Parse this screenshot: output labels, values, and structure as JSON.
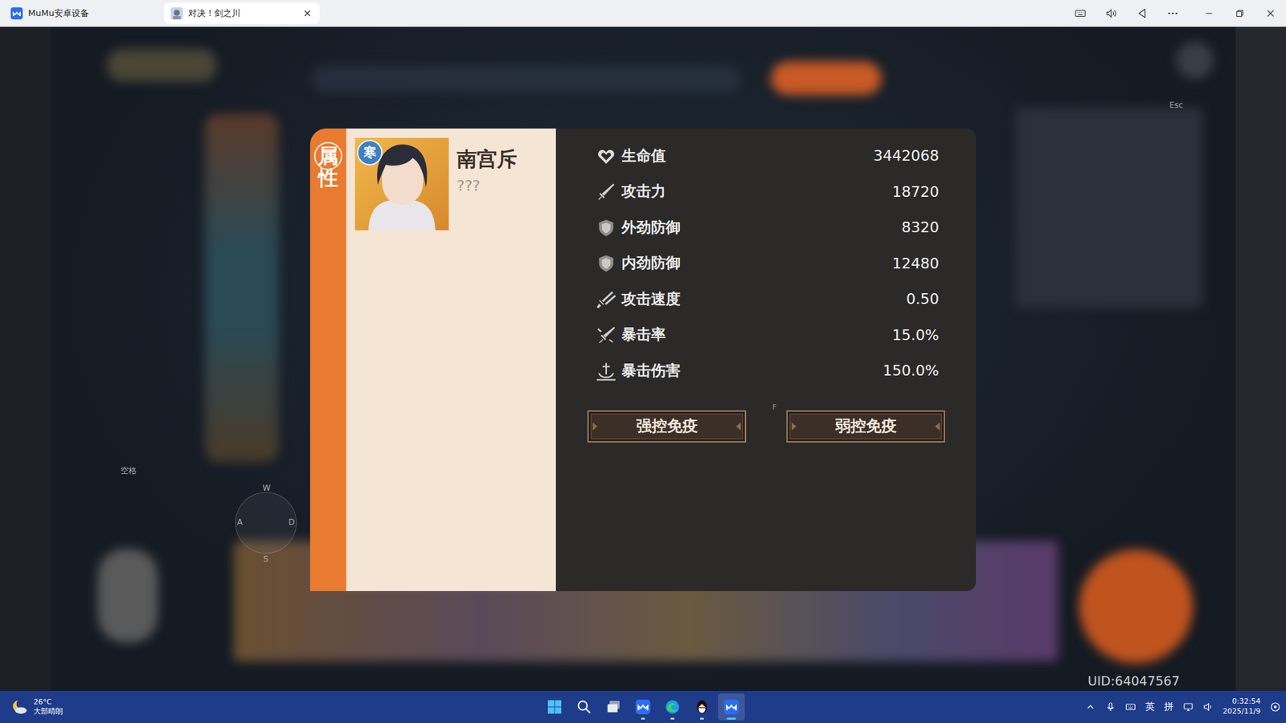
{
  "window": {
    "tabs": [
      {
        "label": "MuMu安卓设备",
        "selected": false
      },
      {
        "label": "对决！剑之川",
        "selected": true
      }
    ]
  },
  "game": {
    "key_hints": {
      "jump": "空格",
      "move": {
        "up": "W",
        "left": "A",
        "right": "D",
        "down": "S"
      },
      "interact": "F",
      "menu": "Esc"
    },
    "uid": "UID:64047567"
  },
  "modal": {
    "side_label": "属性",
    "hero": {
      "element": "寒",
      "name": "南宫斥",
      "title": "???"
    },
    "stats": [
      {
        "label": "生命值",
        "value": "3442068"
      },
      {
        "label": "攻击力",
        "value": "18720"
      },
      {
        "label": "外劲防御",
        "value": "8320"
      },
      {
        "label": "内劲防御",
        "value": "12480"
      },
      {
        "label": "攻击速度",
        "value": "0.50"
      },
      {
        "label": "暴击率",
        "value": "15.0%"
      },
      {
        "label": "暴击伤害",
        "value": "150.0%"
      }
    ],
    "buttons": [
      {
        "label": "强控免疫"
      },
      {
        "label": "弱控免疫"
      }
    ]
  },
  "taskbar": {
    "weather": {
      "temperature": "26°C",
      "condition": "大部晴朗"
    },
    "apps": [
      {
        "running": false,
        "selected": false
      },
      {
        "running": false,
        "selected": false
      },
      {
        "running": false,
        "selected": false
      },
      {
        "running": true,
        "selected": false
      },
      {
        "running": true,
        "selected": false
      },
      {
        "running": true,
        "selected": false
      },
      {
        "running": true,
        "selected": true
      }
    ],
    "tray": {
      "language": "英",
      "input_mode": "拼"
    },
    "clock": {
      "time": "0:32:54",
      "date": "2025/11/9"
    }
  }
}
